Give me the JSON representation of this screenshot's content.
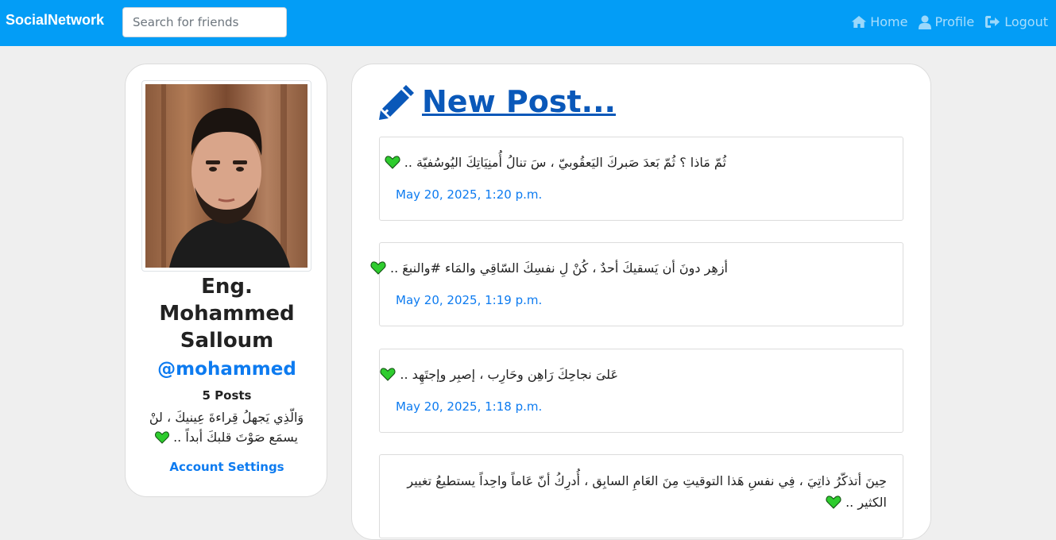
{
  "navbar": {
    "brand": "SocialNetwork",
    "search_placeholder": "Search for friends",
    "links": [
      {
        "label": "Home",
        "icon": "home-icon"
      },
      {
        "label": "Profile",
        "icon": "user-icon"
      },
      {
        "label": "Logout",
        "icon": "logout-icon"
      }
    ],
    "bg_color": "#039df6"
  },
  "profile": {
    "name_lines": [
      "Eng.",
      "Mohammed",
      "Salloum"
    ],
    "username": "@mohammed",
    "posts_count": "5 Posts",
    "bio": "وَالّذِي يَجهلُ قِراءةَ عِينيكَ ، لنْ يسمَع صَوْتَ قلبكَ أبداً ..",
    "settings_label": "Account Settings"
  },
  "feed": {
    "new_post_label": " New Post...",
    "posts": [
      {
        "text": "ثُمّ مَاذا ؟ ثُمّ بَعدَ صَبركَ اليَعقُوبيّ ، سَ تنالُ أُمنِيَاتِكَ اليُوسُفيّة ..",
        "date": "May 20, 2025, 1:20 p.m."
      },
      {
        "text": "أزهِر دونَ أن يَسقيكَ أحدٌ ، كُنْ لِ نفسِكَ السّاقِي والمَاء #والنبعَ ..",
        "date": "May 20, 2025, 1:19 p.m."
      },
      {
        "text": "عَلىَ نجاحِكَ رَاهِن وحَارِب ، إصبِر وإجتَهِد ..",
        "date": "May 20, 2025, 1:18 p.m."
      },
      {
        "text": "حِينَ أتذكّرُ ذاتِيَ ، فِي نفسِ هَذا التوقيتِ مِنَ العَامِ السابِق ، أُدرِكُ أنّ عَاماً واحِداً يستطيعُ تغيير الكثير ..",
        "date": ""
      }
    ]
  }
}
